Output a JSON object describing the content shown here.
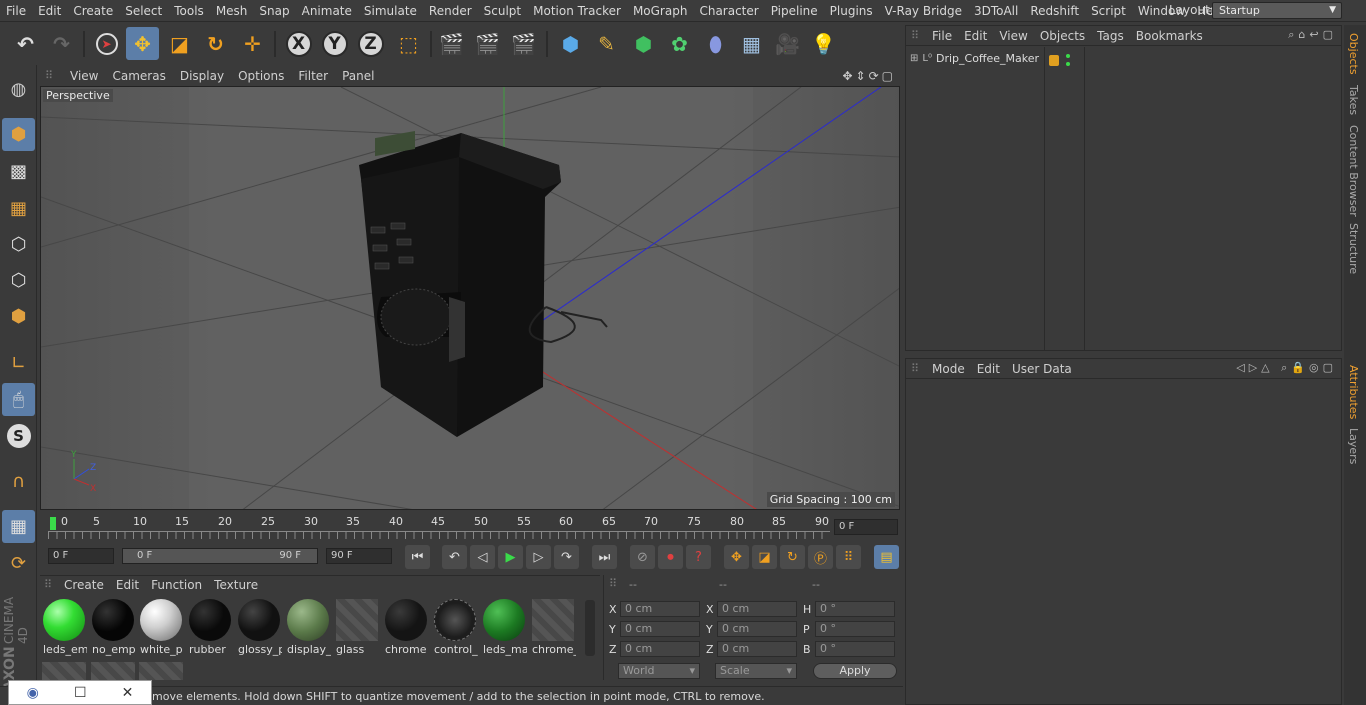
{
  "menu": [
    "File",
    "Edit",
    "Create",
    "Select",
    "Tools",
    "Mesh",
    "Snap",
    "Animate",
    "Simulate",
    "Render",
    "Sculpt",
    "Motion Tracker",
    "MoGraph",
    "Character",
    "Pipeline",
    "Plugins",
    "V-Ray Bridge",
    "3DToAll",
    "Redshift",
    "Script",
    "Window",
    "Help"
  ],
  "layout": {
    "label": "Layout:",
    "value": "Startup"
  },
  "viewport": {
    "menu": [
      "View",
      "Cameras",
      "Display",
      "Options",
      "Filter",
      "Panel"
    ],
    "label": "Perspective",
    "grid_spacing": "Grid Spacing : 100 cm"
  },
  "timeline": {
    "ticks": [
      "0",
      "5",
      "10",
      "15",
      "20",
      "25",
      "30",
      "35",
      "40",
      "45",
      "50",
      "55",
      "60",
      "65",
      "70",
      "75",
      "80",
      "85",
      "90"
    ],
    "current_frame": "0 F"
  },
  "transport": {
    "start": "0 F",
    "range_start": "0 F",
    "range_end": "90 F",
    "end": "90 F"
  },
  "materials": {
    "menu": [
      "Create",
      "Edit",
      "Function",
      "Texture"
    ],
    "items": [
      {
        "label": "leds_em",
        "color": "#44ee44"
      },
      {
        "label": "no_emp",
        "color": "#050505"
      },
      {
        "label": "white_p",
        "color": "#dcdcdc"
      },
      {
        "label": "rubber",
        "color": "#0a0a0a"
      },
      {
        "label": "glossy_p",
        "color": "#111111"
      },
      {
        "label": "display_",
        "color": "#5b7a4a"
      },
      {
        "label": "glass",
        "color": "stripe"
      },
      {
        "label": "chrome",
        "color": "#141414"
      },
      {
        "label": "control_",
        "color": "#1d1d1d"
      },
      {
        "label": "leds_ma",
        "color": "#1c7a22"
      },
      {
        "label": "chrome_",
        "color": "stripe"
      }
    ]
  },
  "coords": {
    "headers": [
      "--",
      "--",
      "--"
    ],
    "rows": [
      {
        "a": "X",
        "av": "0 cm",
        "b": "X",
        "bv": "0 cm",
        "c": "H",
        "cv": "0 °"
      },
      {
        "a": "Y",
        "av": "0 cm",
        "b": "Y",
        "bv": "0 cm",
        "c": "P",
        "cv": "0 °"
      },
      {
        "a": "Z",
        "av": "0 cm",
        "b": "Z",
        "bv": "0 cm",
        "c": "B",
        "cv": "0 °"
      }
    ],
    "space": "World",
    "mode": "Scale",
    "apply": "Apply"
  },
  "status": "move elements. Hold down SHIFT to quantize movement / add to the selection in point mode, CTRL to remove.",
  "objects": {
    "menu": [
      "File",
      "Edit",
      "View",
      "Objects",
      "Tags",
      "Bookmarks"
    ],
    "item": "Drip_Coffee_Maker"
  },
  "attributes": {
    "menu": [
      "Mode",
      "Edit",
      "User Data"
    ]
  },
  "right_tabs": [
    "Objects",
    "Takes",
    "Content Browser",
    "Structure",
    "Attributes",
    "Layers"
  ],
  "branding": {
    "maxon": "MAXON",
    "c4d": "CINEMA 4D"
  },
  "colors": {
    "accent": "#5c7ea8",
    "tab_active": "#f0a030"
  }
}
